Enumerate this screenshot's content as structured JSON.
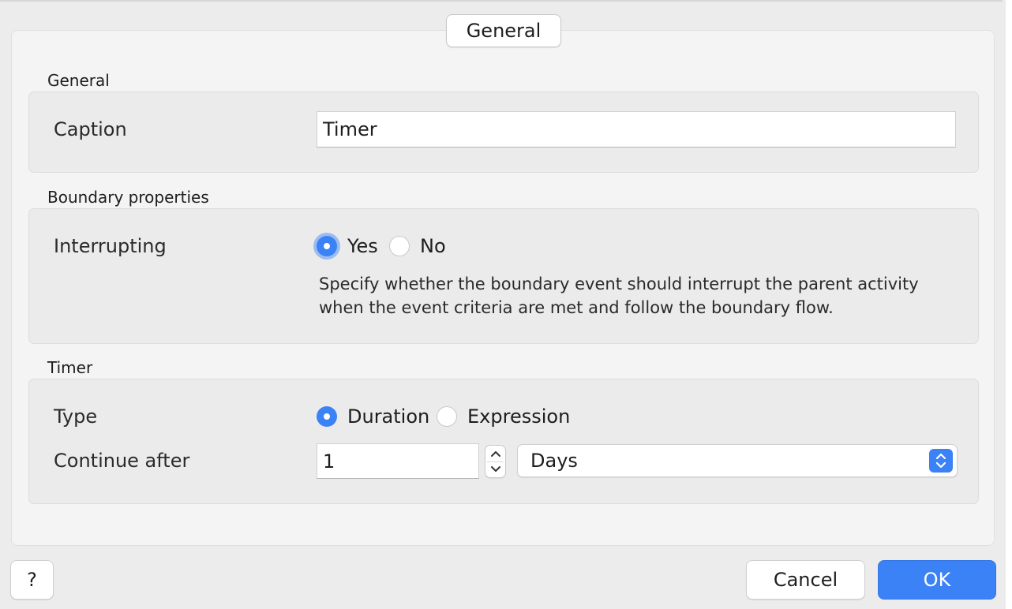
{
  "tabs": {
    "active_label": "General"
  },
  "general": {
    "section_title": "General",
    "caption_label": "Caption",
    "caption_value": "Timer"
  },
  "boundary": {
    "section_title": "Boundary properties",
    "interrupting_label": "Interrupting",
    "options": [
      "Yes",
      "No"
    ],
    "selected": "Yes",
    "help_text": "Specify whether the boundary event should interrupt the parent activity when the event criteria are met and follow the boundary flow."
  },
  "timer": {
    "section_title": "Timer",
    "type_label": "Type",
    "type_options": [
      "Duration",
      "Expression"
    ],
    "type_selected": "Duration",
    "continue_label": "Continue after",
    "continue_value": "1",
    "unit_value": "Days"
  },
  "footer": {
    "help_label": "?",
    "cancel_label": "Cancel",
    "ok_label": "OK"
  },
  "colors": {
    "accent": "#3b82f6",
    "background": "#ececec",
    "panel": "#f4f4f4",
    "group": "#ebebeb"
  },
  "icons": {
    "stepper_up": "chevron-up-icon",
    "stepper_down": "chevron-down-icon",
    "select_caret": "updown-chevron-icon"
  }
}
